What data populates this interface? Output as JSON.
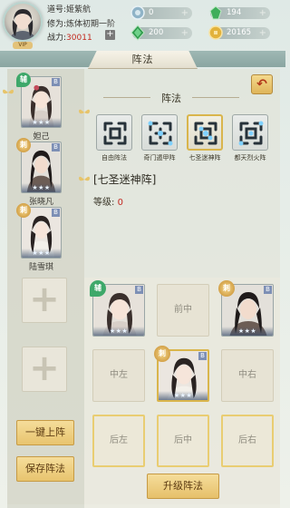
{
  "player": {
    "name_label": "道号:",
    "name": "姬紫航",
    "cultivation_label": "修为:",
    "cultivation": "炼体初期一阶",
    "power_label": "战力:",
    "power": "30011",
    "plus": "+",
    "vip": "VIP"
  },
  "resources": {
    "silver": {
      "value": "0",
      "plus": "+"
    },
    "jade": {
      "value": "194",
      "plus": "+"
    },
    "emerald": {
      "value": "200",
      "plus": "+"
    },
    "gold": {
      "value": "20165",
      "plus": "+"
    }
  },
  "page_title": "阵法",
  "back_label": "↶",
  "section_title": "阵法",
  "roster": [
    {
      "name": "妲己",
      "tag": "辅",
      "tag_type": "fu",
      "quality": "B",
      "stars": "★★★"
    },
    {
      "name": "张晓凡",
      "tag": "刺",
      "tag_type": "ci",
      "quality": "B",
      "stars": "★★★"
    },
    {
      "name": "陆雪琪",
      "tag": "刺",
      "tag_type": "ci",
      "quality": "B",
      "stars": "★★★"
    }
  ],
  "empty_slot_plus": "+",
  "formations": [
    {
      "label": "自由阵法"
    },
    {
      "label": "奇门遁甲阵"
    },
    {
      "label": "七圣迷神阵"
    },
    {
      "label": "都天烈火阵"
    }
  ],
  "selected_formation": {
    "name": "[七圣迷神阵]",
    "level_label": "等级:",
    "level": "0"
  },
  "grid": {
    "front_middle": "前中",
    "middle_left": "中左",
    "middle_right": "中右",
    "back_left": "后左",
    "back_middle": "后中",
    "back_right": "后右",
    "front_left_hero": {
      "tag": "辅",
      "quality": "B",
      "stars": "★★★"
    },
    "front_right_hero": {
      "tag": "刺",
      "quality": "B",
      "stars": "★★★"
    },
    "center_hero": {
      "tag": "刺",
      "quality": "B",
      "stars": "★★★"
    }
  },
  "buttons": {
    "auto_deploy": "一键上阵",
    "save": "保存阵法",
    "upgrade": "升级阵法"
  },
  "colors": {
    "accent_gold": "#e8c46e",
    "power_red": "#c32b20",
    "selected_border": "#d9b54c"
  }
}
